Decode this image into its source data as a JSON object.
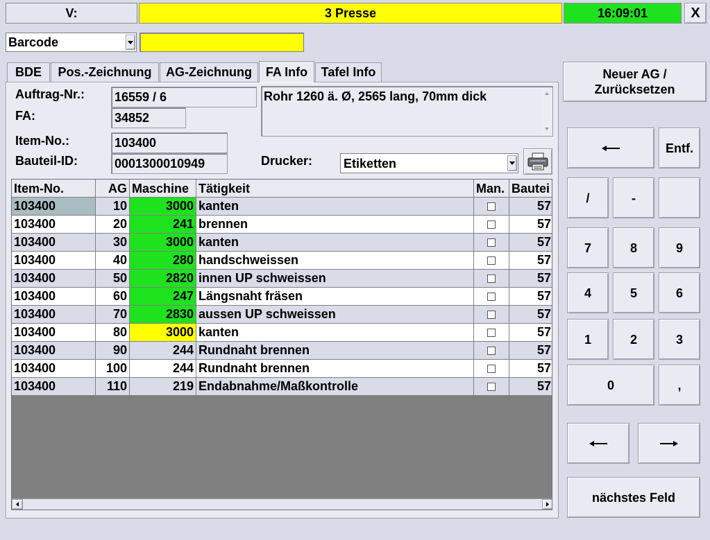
{
  "topbar": {
    "v_label": "V:",
    "station": "3 Presse",
    "time": "16:09:01",
    "close": "X"
  },
  "scan": {
    "mode": "Barcode",
    "value": ""
  },
  "tabs": [
    "BDE",
    "Pos.-Zeichnung",
    "AG-Zeichnung",
    "FA Info",
    "Tafel Info"
  ],
  "active_tab": "FA Info",
  "info": {
    "auftrag_label": "Auftrag-Nr.:",
    "auftrag_value": "16559 / 6",
    "fa_label": "FA:",
    "fa_value": "34852",
    "item_label": "Item-No.:",
    "item_value": "103400",
    "bauteil_label": "Bauteil-ID:",
    "bauteil_value": "0001300010949",
    "description": "Rohr 1260 ä. Ø, 2565 lang, 70mm dick",
    "drucker_label": "Drucker:",
    "drucker_value": "Etiketten"
  },
  "table": {
    "headers": [
      "Item-No.",
      "AG",
      "Maschine",
      "Tätigkeit",
      "Man.",
      "Bautei"
    ],
    "rows": [
      {
        "item": "103400",
        "ag": "10",
        "maschine": "3000",
        "taetigkeit": "kanten",
        "bauteil": "57",
        "status": "green"
      },
      {
        "item": "103400",
        "ag": "20",
        "maschine": "241",
        "taetigkeit": "brennen",
        "bauteil": "57",
        "status": "green"
      },
      {
        "item": "103400",
        "ag": "30",
        "maschine": "3000",
        "taetigkeit": "kanten",
        "bauteil": "57",
        "status": "green"
      },
      {
        "item": "103400",
        "ag": "40",
        "maschine": "280",
        "taetigkeit": "handschweissen",
        "bauteil": "57",
        "status": "green"
      },
      {
        "item": "103400",
        "ag": "50",
        "maschine": "2820",
        "taetigkeit": "innen UP schweissen",
        "bauteil": "57",
        "status": "green"
      },
      {
        "item": "103400",
        "ag": "60",
        "maschine": "247",
        "taetigkeit": "Längsnaht fräsen",
        "bauteil": "57",
        "status": "green"
      },
      {
        "item": "103400",
        "ag": "70",
        "maschine": "2830",
        "taetigkeit": "aussen UP schweissen",
        "bauteil": "57",
        "status": "green"
      },
      {
        "item": "103400",
        "ag": "80",
        "maschine": "3000",
        "taetigkeit": "kanten",
        "bauteil": "57",
        "status": "yellow"
      },
      {
        "item": "103400",
        "ag": "90",
        "maschine": "244",
        "taetigkeit": "Rundnaht brennen",
        "bauteil": "57",
        "status": "none"
      },
      {
        "item": "103400",
        "ag": "100",
        "maschine": "244",
        "taetigkeit": "Rundnaht brennen",
        "bauteil": "57",
        "status": "none"
      },
      {
        "item": "103400",
        "ag": "110",
        "maschine": "219",
        "taetigkeit": "Endabnahme/Maßkontrolle",
        "bauteil": "57",
        "status": "none"
      }
    ]
  },
  "buttons": {
    "neuer_ag": "Neuer AG / Zurücksetzen",
    "entf": "Entf.",
    "slash": "/",
    "minus": "-",
    "comma": ",",
    "k7": "7",
    "k8": "8",
    "k9": "9",
    "k4": "4",
    "k5": "5",
    "k6": "6",
    "k1": "1",
    "k2": "2",
    "k3": "3",
    "k0": "0",
    "next_field": "nächstes Feld"
  },
  "colors": {
    "green": "#1fe21f",
    "yellow": "#ffff00",
    "row_alt": "#d9dbe9",
    "row": "#ffffff",
    "selected": "#a9bcc2",
    "background": "#d9dbe9"
  }
}
